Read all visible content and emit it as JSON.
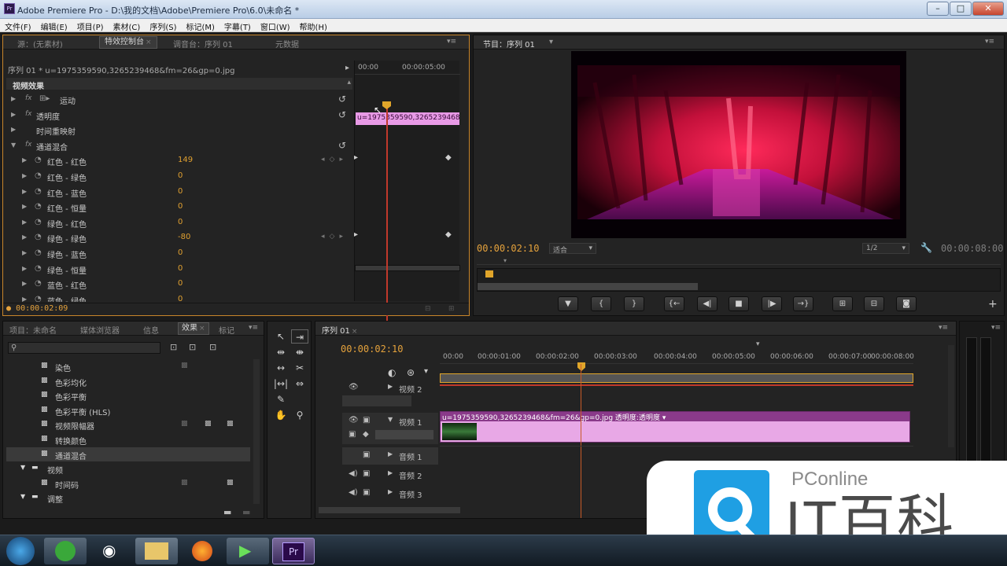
{
  "window": {
    "title": "Adobe Premiere Pro - D:\\我的文档\\Adobe\\Premiere Pro\\6.0\\未命名 *"
  },
  "menu": [
    "文件(F)",
    "编辑(E)",
    "项目(P)",
    "素材(C)",
    "序列(S)",
    "标记(M)",
    "字幕(T)",
    "窗口(W)",
    "帮助(H)"
  ],
  "effect_panel": {
    "tabs": [
      "源：(无素材)",
      "特效控制台",
      "调音台：序列 01",
      "元数据"
    ],
    "sequence_clip": "序列 01 * u=1975359590,3265239468&fm=26&gp=0.jpg",
    "ruler": [
      "00:00",
      "00:00:05:00"
    ],
    "clip_bar": "u=1975359590,3265239468",
    "section": "视频效果",
    "effects": [
      {
        "label": "运动"
      },
      {
        "label": "透明度"
      },
      {
        "label": "时间重映射"
      },
      {
        "label": "通道混合"
      }
    ],
    "params": [
      {
        "label": "红色 - 红色",
        "value": "149"
      },
      {
        "label": "红色 - 绿色",
        "value": "0"
      },
      {
        "label": "红色 - 蓝色",
        "value": "0"
      },
      {
        "label": "红色 - 恒量",
        "value": "0"
      },
      {
        "label": "绿色 - 红色",
        "value": "0"
      },
      {
        "label": "绿色 - 绿色",
        "value": "-80"
      },
      {
        "label": "绿色 - 蓝色",
        "value": "0"
      },
      {
        "label": "绿色 - 恒量",
        "value": "0"
      },
      {
        "label": "蓝色 - 红色",
        "value": "0"
      },
      {
        "label": "蓝色 - 绿色",
        "value": "0"
      }
    ],
    "timecode": "00:00:02:09"
  },
  "program_monitor": {
    "tab": "节目：序列 01",
    "current_tc": "00:00:02:10",
    "fit": "适合",
    "resolution": "1/2",
    "duration_tc": "00:00:08:00",
    "transport": [
      "▼",
      "{",
      "}",
      "{←",
      "◀|",
      "■",
      "|▶",
      "→}",
      "⊞",
      "⊟",
      "◙"
    ]
  },
  "project_panel": {
    "tabs": [
      "项目：未命名",
      "媒体浏览器",
      "信息",
      "效果",
      "标记"
    ],
    "items": [
      {
        "label": "染色",
        "level": 2
      },
      {
        "label": "色彩均化",
        "level": 2
      },
      {
        "label": "色彩平衡",
        "level": 2
      },
      {
        "label": "色彩平衡 (HLS)",
        "level": 2
      },
      {
        "label": "视频限幅器",
        "level": 2
      },
      {
        "label": "转换颜色",
        "level": 2
      },
      {
        "label": "通道混合",
        "level": 2,
        "selected": true
      },
      {
        "label": "视频",
        "level": 1
      },
      {
        "label": "时间码",
        "level": 2
      },
      {
        "label": "调整",
        "level": 1
      }
    ]
  },
  "timeline": {
    "tab": "序列 01",
    "current_tc": "00:00:02:10",
    "ruler": [
      "00:00",
      "00:00:01:00",
      "00:00:02:00",
      "00:00:03:00",
      "00:00:04:00",
      "00:00:05:00",
      "00:00:06:00",
      "00:00:07:00",
      "00:00:08:00"
    ],
    "tracks": [
      {
        "name": "视频 2",
        "type": "video"
      },
      {
        "name": "视频 1",
        "type": "video"
      },
      {
        "name": "音频 1",
        "type": "audio"
      },
      {
        "name": "音频 2",
        "type": "audio"
      },
      {
        "name": "音频 3",
        "type": "audio"
      }
    ],
    "clip_label": "u=1975359590,3265239468&fm=26&gp=0.jpg  透明度:透明度 ▾"
  },
  "watermark": {
    "brand": "PConline",
    "title": "IT百科"
  },
  "colors": {
    "accent_orange": "#e5a23c",
    "playhead_red": "#c0392b",
    "clip_pink": "#e8a8e6"
  }
}
